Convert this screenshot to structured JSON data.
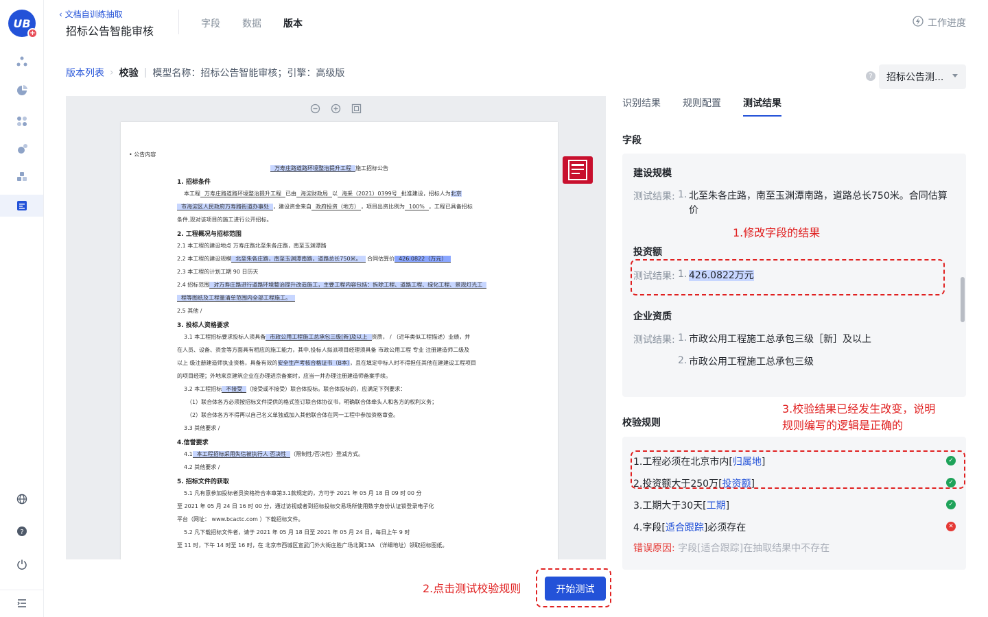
{
  "header": {
    "back_label": "文档自训练抽取",
    "title": "招标公告智能审核",
    "tabs": [
      "字段",
      "数据",
      "版本"
    ],
    "active_tab": "版本",
    "progress_label": "工作进度"
  },
  "logo": {
    "text": "UB",
    "badge": "+"
  },
  "breadcrumb": {
    "list": "版本列表",
    "current": "校验",
    "sep_bar": "|",
    "info": "模型名称：招标公告智能审核；引擎：高级版"
  },
  "model_select": {
    "value": "招标公告测..."
  },
  "doc": {
    "section": "• 公告内容",
    "title_hl": "万寿庄路道路环境整治提升工程",
    "title_rest": "施工招标公告",
    "h1": "1. 招标条件",
    "p1a": "本工程",
    "p1b": "万寿庄路道路环境整治提升工程",
    "p1c": "已由",
    "p1d": "海淀财政局",
    "p1e": "以",
    "p1f": "海采（2021）0399号",
    "p1g": "批准建设，招标人为",
    "p1h": "北京",
    "p2a": "市海淀区人民政府万寿路街道办事处",
    "p2b": "，建设资金来自",
    "p2c": "政府投资（地方）",
    "p2d": "，项目出资比例为",
    "p2e": "100%",
    "p2f": "，工程已具备招标",
    "p3": "条件,现对该项目的施工进行公开招标。",
    "h2": "2. 工程概况与招标范围",
    "l21": "2.1  本工程的建设地点  万寿庄路北至朱各庄路，南至玉渊潭路",
    "l22a": "2.2  本工程的建设规模",
    "l22b": "北至朱各庄路，南至玉渊潭南路，道路总长750米。",
    "l22c": "合同估算价",
    "l22d": "426.0822（万元）",
    "l23": "2.3  本工程的计划工期   90   日历天",
    "l24a": "2.4  招标范围",
    "l24b": "对万寿庄路进行道路环境整治提升改造施工，主要工程内容包括：拆除工程、道路工程、绿化工程、景观灯光工",
    "l24c": "程等图纸及工程量清单范围内全部工程施工。",
    "l25": "2.5  其他    /",
    "h3": "3. 投标人资格要求",
    "l31a": "3.1 本工程招标要求投标人须具备",
    "l31b": "市政公用工程施工总承包三级[新]及以上",
    "l31c": "资质，   /    （近年类似工程描述）业绩，并",
    "l32": "在人员、设备、资金等方面具有相应的施工能力，其中,投标人拟派项目经理须具备    市政公用工程    专业    注册建造师二级及",
    "l33a": "以上    级注册建造师执业资格，具备有效的",
    "l33b": "安全生产考核合格证书（B本）",
    "l33c": "，且在填定中标人时不得担任其他在建建设工程项目",
    "l34": "的项目经理；外地来京建筑企业在办理进京备案时，应当一并办理注册建造师备案手续。",
    "l35a": "3.2 本工程招标",
    "l35b": "不接受",
    "l35c": "（接受或不接受）联合体投标。联合体投标的，应满足下列要求：",
    "l36": "（1）联合体各方必须按招标文件提供的格式签订联合体协议书，明确联合体牵头人和各方的权利义务；",
    "l37": "（2）联合体各方不得再以自己名义单独或加入其他联合体在同一工程中参加资格审查。",
    "l38": "3.3 其他要求    /",
    "h4": "4.信誉要求",
    "l41a": "4.1",
    "l41b": "本工程招标采用失信被执行人   否决性",
    "l41c": "（限制性/否决性）登减方式。",
    "l42": "4.2 其他要求    /",
    "h5": "5. 招标文件的获取",
    "l51": "5.1 凡有意参加投标者员资格符合本章第3.1款规定的，方可于    2021    年    05    月    18    日    09    时    00    分",
    "l52": "至    2021    年    05    月    24    日    16    时    00    分，通过访视或者到招标投标交易场所使用数字身份认证锁登录电子化",
    "l53": "平台（网址：   www.bcactc.com    ）下载招标文件。",
    "l54": "5.2 凡下载招标文件者，请于    2021    年    05    月    18    日至    2021    年    05    月    24    日，每日上午    9    时",
    "l55": "至    11    时，下午    14    时至    16    时，在    北京市西城区宣武门外大街庄胜广场北翼13A    （详细地址）领取招标图纸。"
  },
  "right": {
    "tabs": [
      "识别结果",
      "规则配置",
      "测试结果"
    ],
    "active_tab": "测试结果",
    "fields_title": "字段",
    "result_label": "测试结果:",
    "fields": [
      {
        "name": "建设规模",
        "results": [
          "北至朱各庄路，南至玉渊潭南路，道路总长750米。合同估算价"
        ]
      },
      {
        "name": "投资额",
        "results": [
          "426.0822万元"
        ]
      },
      {
        "name": "企业资质",
        "results": [
          "市政公用工程施工总承包三级［新］及以上",
          "市政公用工程施工总承包三级"
        ]
      }
    ],
    "rules_title": "校验规则",
    "rules": [
      {
        "pre": "1.工程必须在北京市内[",
        "tag": "归属地",
        "post": "]",
        "status": "pass"
      },
      {
        "pre": "2.投资额大于250万[",
        "tag": "投资额",
        "post": "]",
        "status": "pass"
      },
      {
        "pre": "3.工期大于30天[",
        "tag": "工期",
        "post": "]",
        "status": "pass"
      },
      {
        "pre": "4.字段[",
        "tag": "适合跟踪",
        "post": "]必须存在",
        "status": "fail"
      }
    ],
    "error_label": "错误原因:",
    "error_text": "字段[适合跟踪]在抽取结果中不存在",
    "start_button": "开始测试",
    "nums": [
      "1.",
      "2."
    ],
    "status_glyphs": {
      "pass": "✓",
      "fail": "✕"
    }
  },
  "annotations": {
    "note1": "1.修改字段的结果",
    "note2": "2.点击测试校验规则",
    "note3a": "3.校验结果已经发生改变，说明",
    "note3b": "规则编写的逻辑是正确的"
  },
  "colors": {
    "accent": "#2352d8",
    "annotation": "#e02020",
    "pass": "#1fa35a",
    "fail": "#e53935"
  }
}
